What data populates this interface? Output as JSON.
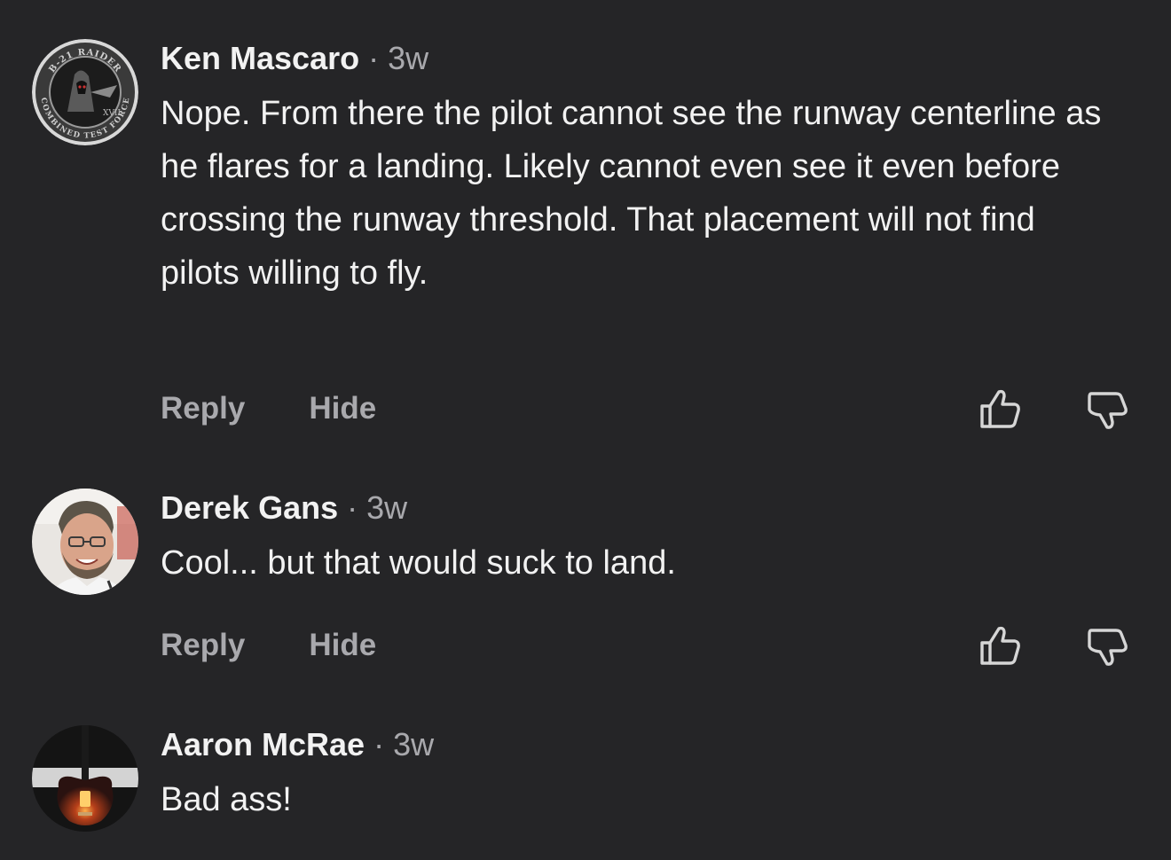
{
  "comments": [
    {
      "author": "Ken Mascaro",
      "separator": "·",
      "time": "3w",
      "text": "Nope. From there the pilot cannot see the runway centerline as he flares for a landing. Likely cannot even see it even before crossing the runway threshold. That placement will not find pilots willing to fly.",
      "avatar_badge_top": "B-21 RAIDER",
      "avatar_badge_bottom": "COMBINED TEST FORCE",
      "avatar_badge_mark": "XVII",
      "reply_label": "Reply",
      "hide_label": "Hide",
      "like_icon": "thumbs-up-icon",
      "dislike_icon": "thumbs-down-icon"
    },
    {
      "author": "Derek Gans",
      "separator": "·",
      "time": "3w",
      "text": "Cool... but that would suck to land.",
      "reply_label": "Reply",
      "hide_label": "Hide",
      "like_icon": "thumbs-up-icon",
      "dislike_icon": "thumbs-down-icon"
    },
    {
      "author": "Aaron McRae",
      "separator": "·",
      "time": "3w",
      "text": "Bad ass!"
    }
  ],
  "colors": {
    "background": "#252527",
    "text": "#f2f2f2",
    "secondary": "#a9a9ad"
  }
}
